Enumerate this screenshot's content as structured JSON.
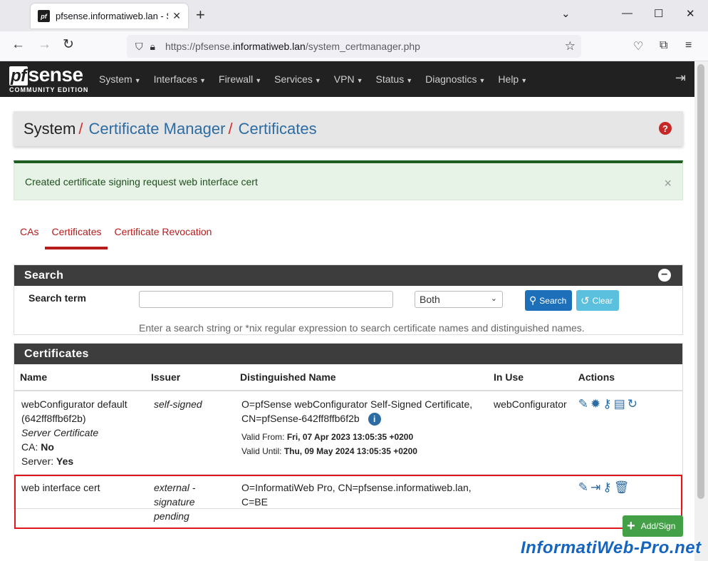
{
  "browser": {
    "tab_title": "pfsense.informatiweb.lan - Syst",
    "url_prefix": "https://pfsense.",
    "url_domain": "informatiweb.lan",
    "url_path": "/system_certmanager.php"
  },
  "nav": {
    "logo_text": "sense",
    "logo_pf": "pf",
    "logo_sub": "COMMUNITY EDITION",
    "items": [
      "System",
      "Interfaces",
      "Firewall",
      "Services",
      "VPN",
      "Status",
      "Diagnostics",
      "Help"
    ]
  },
  "breadcrumb": {
    "root": "System",
    "sep": "/",
    "level1": "Certificate Manager",
    "level2": "Certificates"
  },
  "alert": {
    "message": "Created certificate signing request web interface cert"
  },
  "tabs": [
    "CAs",
    "Certificates",
    "Certificate Revocation"
  ],
  "search": {
    "panel_title": "Search",
    "label": "Search term",
    "input_value": "",
    "select_value": "Both",
    "search_btn": "Search",
    "clear_btn": "Clear",
    "help": "Enter a search string or *nix regular expression to search certificate names and distinguished names."
  },
  "certs": {
    "panel_title": "Certificates",
    "headers": [
      "Name",
      "Issuer",
      "Distinguished Name",
      "In Use",
      "Actions"
    ],
    "rows": [
      {
        "name": "webConfigurator default (642ff8ffb6f2b)",
        "type": "Server Certificate",
        "ca_label": "CA:",
        "ca_value": "No",
        "server_label": "Server:",
        "server_value": "Yes",
        "issuer": "self-signed",
        "dn": "O=pfSense webConfigurator Self-Signed Certificate, CN=pfSense-642ff8ffb6f2b",
        "valid_from_label": "Valid From:",
        "valid_from": "Fri, 07 Apr 2023 13:05:35 +0200",
        "valid_until_label": "Valid Until:",
        "valid_until": "Thu, 09 May 2024 13:05:35 +0200",
        "in_use": "webConfigurator"
      },
      {
        "name": "web interface cert",
        "issuer": "external - signature pending",
        "dn": "O=InformatiWeb Pro, CN=pfsense.informatiweb.lan, C=BE",
        "in_use": ""
      }
    ]
  },
  "add_button": "Add/Sign",
  "watermark": "InformatiWeb-Pro.net"
}
